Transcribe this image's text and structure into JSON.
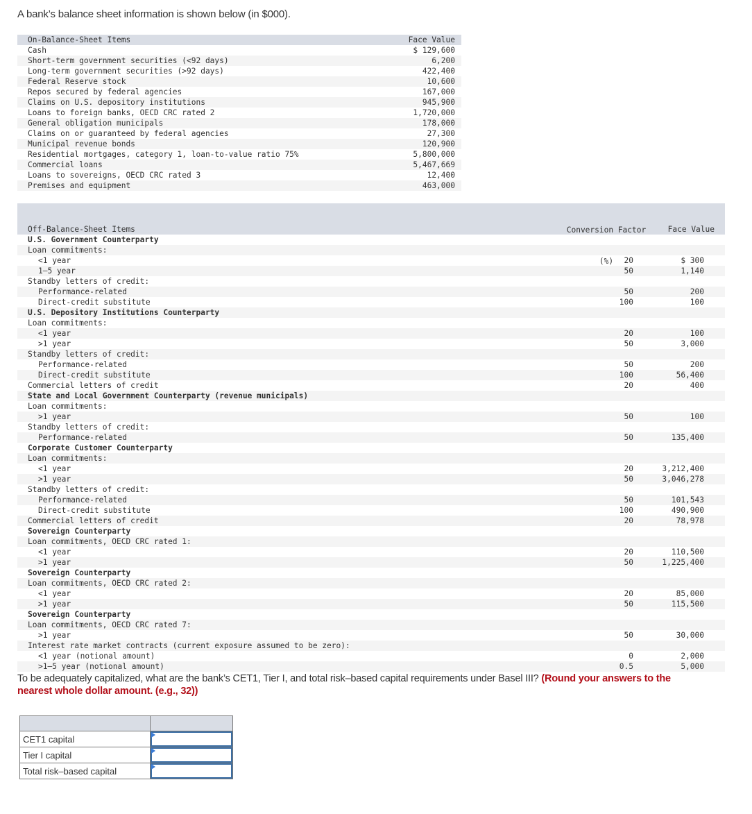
{
  "intro": "A bank’s balance sheet information is shown below (in $000).",
  "on_balance": {
    "header": {
      "label": "On-Balance-Sheet Items",
      "face_value": "Face Value"
    },
    "rows": [
      {
        "label": "Cash",
        "face_value": "$ 129,600"
      },
      {
        "label": "Short-term government securities (<92 days)",
        "face_value": "6,200"
      },
      {
        "label": "Long-term government securities (>92 days)",
        "face_value": "422,400"
      },
      {
        "label": "Federal Reserve stock",
        "face_value": "10,600"
      },
      {
        "label": "Repos secured by federal agencies",
        "face_value": "167,000"
      },
      {
        "label": "Claims on U.S. depository institutions",
        "face_value": "945,900"
      },
      {
        "label": "Loans to foreign banks, OECD CRC rated 2",
        "face_value": "1,720,000"
      },
      {
        "label": "General obligation municipals",
        "face_value": "178,000"
      },
      {
        "label": "Claims on or guaranteed by federal agencies",
        "face_value": "27,300"
      },
      {
        "label": "Municipal revenue bonds",
        "face_value": "120,900"
      },
      {
        "label": "Residential mortgages, category 1, loan-to-value ratio 75%",
        "face_value": "5,800,000"
      },
      {
        "label": "Commercial loans",
        "face_value": "5,467,669"
      },
      {
        "label": "Loans to sovereigns, OECD CRC rated 3",
        "face_value": "12,400"
      },
      {
        "label": "Premises and equipment",
        "face_value": "463,000"
      }
    ]
  },
  "off_balance": {
    "header": {
      "label": "Off-Balance-Sheet Items",
      "conversion_factor_line1": "Conversion Factor",
      "conversion_factor_line2": "(%)",
      "face_value": "Face Value"
    },
    "rows": [
      {
        "label": "U.S. Government Counterparty",
        "style": "bold",
        "cf": "",
        "fv": ""
      },
      {
        "label": "Loan commitments:",
        "style": "",
        "cf": "",
        "fv": ""
      },
      {
        "label": "<1 year",
        "style": "ind",
        "cf": "20",
        "fv": "$ 300"
      },
      {
        "label": "1–5 year",
        "style": "ind",
        "cf": "50",
        "fv": "1,140"
      },
      {
        "label": "Standby letters of credit:",
        "style": "",
        "cf": "",
        "fv": ""
      },
      {
        "label": "Performance-related",
        "style": "ind",
        "cf": "50",
        "fv": "200"
      },
      {
        "label": "Direct-credit substitute",
        "style": "ind",
        "cf": "100",
        "fv": "100"
      },
      {
        "label": "U.S. Depository Institutions Counterparty",
        "style": "bold",
        "cf": "",
        "fv": ""
      },
      {
        "label": "Loan commitments:",
        "style": "",
        "cf": "",
        "fv": ""
      },
      {
        "label": "<1 year",
        "style": "ind",
        "cf": "20",
        "fv": "100"
      },
      {
        "label": ">1 year",
        "style": "ind",
        "cf": "50",
        "fv": "3,000"
      },
      {
        "label": "Standby letters of credit:",
        "style": "",
        "cf": "",
        "fv": ""
      },
      {
        "label": "Performance-related",
        "style": "ind",
        "cf": "50",
        "fv": "200"
      },
      {
        "label": "Direct-credit substitute",
        "style": "ind",
        "cf": "100",
        "fv": "56,400"
      },
      {
        "label": "Commercial letters of credit",
        "style": "",
        "cf": "20",
        "fv": "400"
      },
      {
        "label": "State and Local Government Counterparty (revenue municipals)",
        "style": "bold",
        "cf": "",
        "fv": ""
      },
      {
        "label": "Loan commitments:",
        "style": "",
        "cf": "",
        "fv": ""
      },
      {
        "label": ">1 year",
        "style": "ind",
        "cf": "50",
        "fv": "100"
      },
      {
        "label": "Standby letters of credit:",
        "style": "",
        "cf": "",
        "fv": ""
      },
      {
        "label": "Performance-related",
        "style": "ind",
        "cf": "50",
        "fv": "135,400"
      },
      {
        "label": "Corporate Customer Counterparty",
        "style": "bold",
        "cf": "",
        "fv": ""
      },
      {
        "label": "Loan commitments:",
        "style": "",
        "cf": "",
        "fv": ""
      },
      {
        "label": "<1 year",
        "style": "ind",
        "cf": "20",
        "fv": "3,212,400"
      },
      {
        "label": ">1 year",
        "style": "ind",
        "cf": "50",
        "fv": "3,046,278"
      },
      {
        "label": "Standby letters of credit:",
        "style": "",
        "cf": "",
        "fv": ""
      },
      {
        "label": "Performance-related",
        "style": "ind",
        "cf": "50",
        "fv": "101,543"
      },
      {
        "label": "Direct-credit substitute",
        "style": "ind",
        "cf": "100",
        "fv": "490,900"
      },
      {
        "label": "Commercial letters of credit",
        "style": "",
        "cf": "20",
        "fv": "78,978"
      },
      {
        "label": "Sovereign Counterparty",
        "style": "bold",
        "cf": "",
        "fv": ""
      },
      {
        "label": "Loan commitments, OECD CRC rated 1:",
        "style": "",
        "cf": "",
        "fv": ""
      },
      {
        "label": "<1 year",
        "style": "ind",
        "cf": "20",
        "fv": "110,500"
      },
      {
        "label": ">1 year",
        "style": "ind",
        "cf": "50",
        "fv": "1,225,400"
      },
      {
        "label": "Sovereign Counterparty",
        "style": "bold",
        "cf": "",
        "fv": ""
      },
      {
        "label": "Loan commitments, OECD CRC rated 2:",
        "style": "",
        "cf": "",
        "fv": ""
      },
      {
        "label": "<1 year",
        "style": "ind",
        "cf": "20",
        "fv": "85,000"
      },
      {
        "label": ">1 year",
        "style": "ind",
        "cf": "50",
        "fv": "115,500"
      },
      {
        "label": "Sovereign Counterparty",
        "style": "bold",
        "cf": "",
        "fv": ""
      },
      {
        "label": "Loan commitments, OECD CRC rated 7:",
        "style": "",
        "cf": "",
        "fv": ""
      },
      {
        "label": ">1 year",
        "style": "ind",
        "cf": "50",
        "fv": "30,000"
      },
      {
        "label": "Interest rate market contracts (current exposure assumed to be zero):",
        "style": "",
        "cf": "",
        "fv": ""
      },
      {
        "label": "<1 year (notional amount)",
        "style": "ind",
        "cf": "0",
        "fv": "2,000"
      },
      {
        "label": ">1–5 year (notional amount)",
        "style": "ind",
        "cf": "0.5",
        "fv": "5,000"
      }
    ]
  },
  "question": {
    "text": "To be adequately capitalized, what are the bank’s CET1, Tier I, and total risk–based capital requirements under Basel III? ",
    "hint": "(Round your answers to the nearest whole dollar amount. (e.g., 32))"
  },
  "answers": {
    "rows": [
      {
        "label": "CET1 capital",
        "value": ""
      },
      {
        "label": "Tier I capital",
        "value": ""
      },
      {
        "label": "Total risk–based capital",
        "value": ""
      }
    ]
  }
}
